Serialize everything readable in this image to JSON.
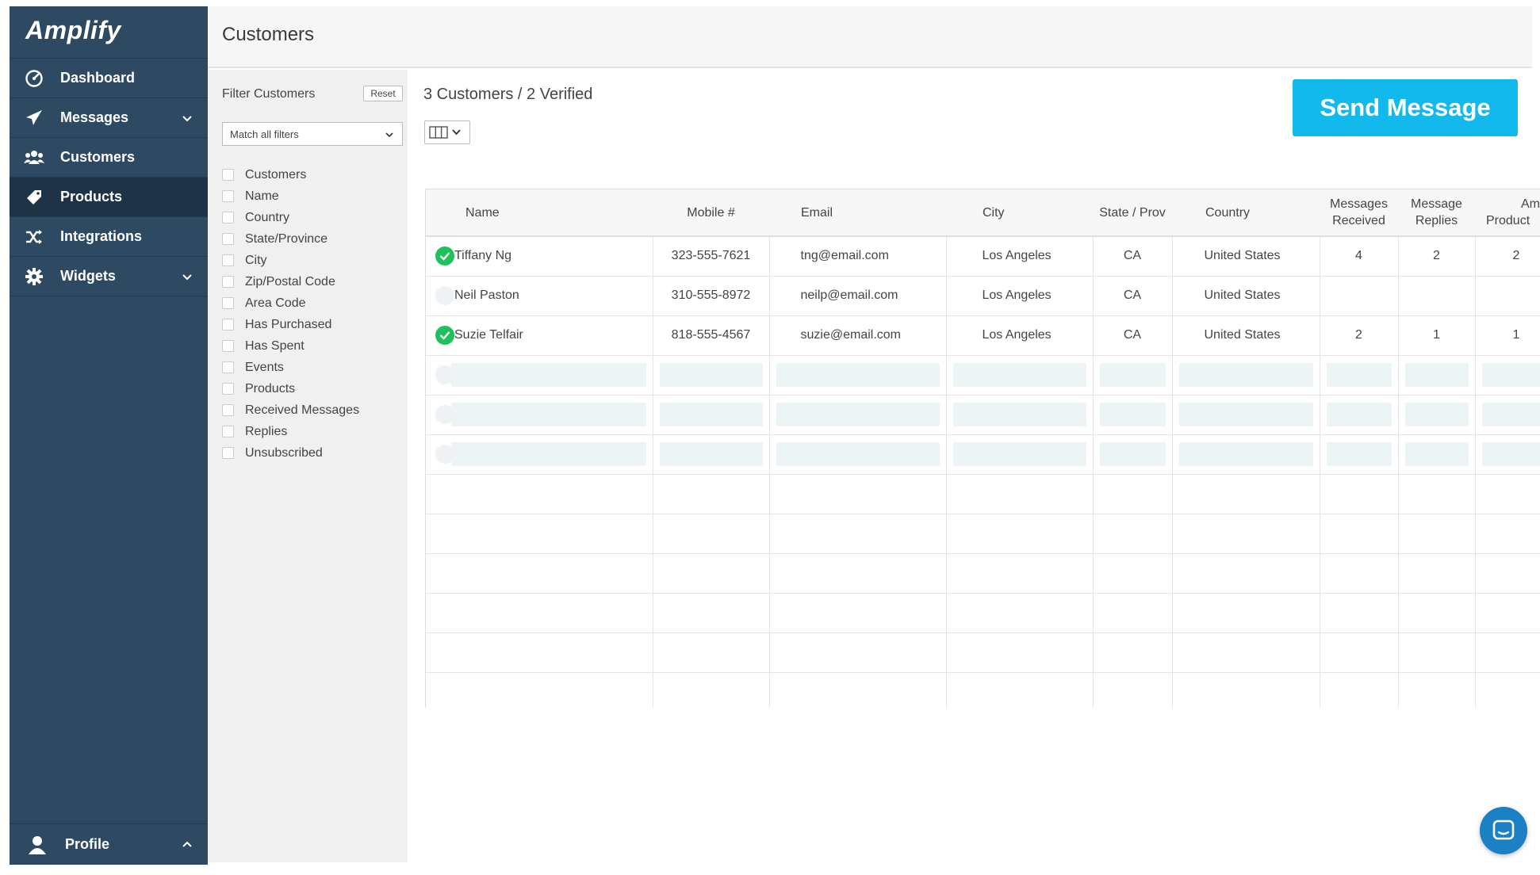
{
  "app": {
    "logo": "Amplify"
  },
  "sidebar": {
    "items": [
      {
        "label": "Dashboard",
        "icon": "dashboard-gauge-icon"
      },
      {
        "label": "Messages",
        "icon": "paper-plane-icon"
      },
      {
        "label": "Customers",
        "icon": "users-icon"
      },
      {
        "label": "Products",
        "icon": "tag-icon"
      },
      {
        "label": "Integrations",
        "icon": "shuffle-icon"
      },
      {
        "label": "Widgets",
        "icon": "gear-icon"
      }
    ],
    "profile_label": "Profile"
  },
  "header": {
    "title": "Customers"
  },
  "filters": {
    "title": "Filter Customers",
    "reset_label": "Reset",
    "match_value": "Match all filters",
    "options": [
      "Customers",
      "Name",
      "Country",
      "State/Province",
      "City",
      "Zip/Postal Code",
      "Area Code",
      "Has Purchased",
      "Has Spent",
      "Events",
      "Products",
      "Received Messages",
      "Replies",
      "Unsubscribed"
    ]
  },
  "main": {
    "count_text": "3 Customers / 2 Verified",
    "send_button": "Send Message"
  },
  "table": {
    "headers": {
      "name": "Name",
      "mobile": "Mobile #",
      "email": "Email",
      "city": "City",
      "state": "State / Prov",
      "country": "Country",
      "messages_received_1": "Messages",
      "messages_received_2": "Received",
      "message_replies_1": "Message",
      "message_replies_2": "Replies",
      "amount_products_1": "Am",
      "amount_products_2": "Product"
    },
    "rows": [
      {
        "verified": true,
        "name": "Tiffany Ng",
        "mobile": "323-555-7621",
        "email": "tng@email.com",
        "city": "Los Angeles",
        "state": "CA",
        "country": "United States",
        "received": "4",
        "replies": "2",
        "amount": "2"
      },
      {
        "verified": false,
        "name": "Neil Paston",
        "mobile": "310-555-8972",
        "email": "neilp@email.com",
        "city": "Los Angeles",
        "state": "CA",
        "country": "United States",
        "received": "",
        "replies": "",
        "amount": ""
      },
      {
        "verified": true,
        "name": "Suzie Telfair",
        "mobile": "818-555-4567",
        "email": "suzie@email.com",
        "city": "Los Angeles",
        "state": "CA",
        "country": "United States",
        "received": "2",
        "replies": "1",
        "amount": "1"
      }
    ]
  },
  "colors": {
    "sidebar": "#2e4a63",
    "sidebar_active": "#1f3347",
    "accent": "#12b9ec",
    "verified": "#1fc15a",
    "chat": "#1b80c4"
  }
}
